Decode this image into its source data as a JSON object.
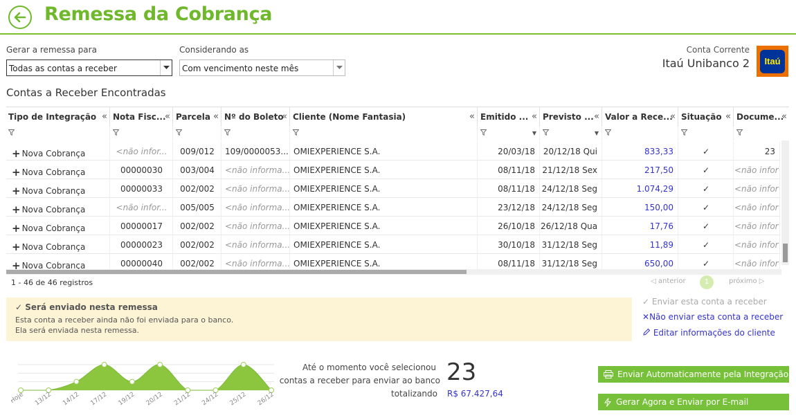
{
  "header": {
    "title": "Remessa da Cobrança"
  },
  "filters": {
    "remessa_label": "Gerar a remessa para",
    "remessa_value": "Todas as contas a receber",
    "considerando_label": "Considerando as",
    "considerando_value": "Com vencimento neste mês"
  },
  "bank": {
    "label": "Conta Corrente",
    "name": "Itaú Unibanco 2",
    "logo_text": "Itaú",
    "logo_color": "#ec7000"
  },
  "section_title": "Contas a Receber Encontradas",
  "columns": [
    "Tipo de Integração",
    "Nota Fisc...",
    "Parcela",
    "Nº do Boleto",
    "Cliente (Nome Fantasia)",
    "Emitido ...",
    "Previsto ...",
    "Valor a Rece...",
    "Situação",
    "Docume..."
  ],
  "rows": [
    {
      "tipo": "Nova Cobrança",
      "nota": "<não infor...",
      "parcela": "009/012",
      "boleto": "109/0000053...",
      "cliente": "OMIEXPERIENCE S.A.",
      "emitido": "20/03/18",
      "previsto": "20/12/18 Qui",
      "valor": "833,33",
      "situacao": "✓",
      "documento": "23"
    },
    {
      "tipo": "Nova Cobrança",
      "nota": "00000030",
      "parcela": "003/004",
      "boleto": "<não informa...",
      "cliente": "OMIEXPERIENCE S.A.",
      "emitido": "08/11/18",
      "previsto": "21/12/18 Sex",
      "valor": "217,50",
      "situacao": "✓",
      "documento": "<não infor"
    },
    {
      "tipo": "Nova Cobrança",
      "nota": "00000033",
      "parcela": "002/002",
      "boleto": "<não informa...",
      "cliente": "OMIEXPERIENCE S.A.",
      "emitido": "08/11/18",
      "previsto": "24/12/18 Seg",
      "valor": "1.074,29",
      "situacao": "✓",
      "documento": "<não infor"
    },
    {
      "tipo": "Nova Cobrança",
      "nota": "<não infor...",
      "parcela": "005/005",
      "boleto": "<não informa...",
      "cliente": "OMIEXPERIENCE S.A.",
      "emitido": "23/12/18",
      "previsto": "24/12/18 Seg",
      "valor": "150,00",
      "situacao": "✓",
      "documento": "<não infor"
    },
    {
      "tipo": "Nova Cobrança",
      "nota": "00000017",
      "parcela": "002/002",
      "boleto": "<não informa...",
      "cliente": "OMIEXPERIENCE S.A.",
      "emitido": "26/10/18",
      "previsto": "26/12/18 Qua",
      "valor": "17,76",
      "situacao": "✓",
      "documento": "<não infor"
    },
    {
      "tipo": "Nova Cobrança",
      "nota": "00000023",
      "parcela": "002/002",
      "boleto": "<não informa...",
      "cliente": "OMIEXPERIENCE S.A.",
      "emitido": "30/10/18",
      "previsto": "31/12/18 Seg",
      "valor": "11,89",
      "situacao": "✓",
      "documento": "<não infor"
    },
    {
      "tipo": "Nova Cobrança",
      "nota": "00000040",
      "parcela": "002/002",
      "boleto": "<não informa...",
      "cliente": "OMIEXPERIENCE S.A.",
      "emitido": "08/11/18",
      "previsto": "31/12/18 Seg",
      "valor": "650,00",
      "situacao": "✓",
      "documento": "<não infor"
    }
  ],
  "pagination": {
    "count": "1 - 46 de 46 registros",
    "prev": "anterior",
    "page": "1",
    "next": "próximo"
  },
  "notice": {
    "title": "Será enviado nesta remessa",
    "line1": "Esta conta a receber ainda não foi enviada para o banco.",
    "line2": "Ela será enviada nesta remessa."
  },
  "actions": {
    "send": "Enviar esta conta a receber",
    "dont_send": "Não enviar esta conta a receber",
    "edit_client": "Editar informações do cliente"
  },
  "chart_data": {
    "type": "area",
    "x": [
      "Hoje",
      "13/12",
      "14/12",
      "17/12",
      "19/12",
      "20/12",
      "21/12",
      "24/12",
      "25/12",
      "26/12"
    ],
    "points": [
      {
        "x": "Hoje",
        "y": 0
      },
      {
        "x": "13/12",
        "y": 0
      },
      {
        "x": "14/12",
        "y": 1
      },
      {
        "x": "17/12",
        "y": 3
      },
      {
        "x": "19/12",
        "y": 1
      },
      {
        "x": "20/12",
        "y": 3
      },
      {
        "x": "21/12",
        "y": 0
      },
      {
        "x": "24/12",
        "y": 0
      },
      {
        "x": "25/12",
        "y": 3
      },
      {
        "x": "26/12",
        "y": 0
      }
    ],
    "ylim": [
      0,
      3
    ],
    "color": "#8cc63f"
  },
  "summary": {
    "line1": "Até o momento você selecionou",
    "line2": "contas a receber para enviar ao banco",
    "line3": "totalizando",
    "count": "23",
    "total": "R$ 67.427,64"
  },
  "buttons": {
    "auto": "Enviar Automaticamente pela Integração",
    "email": "Gerar Agora e Enviar por E-mail"
  }
}
